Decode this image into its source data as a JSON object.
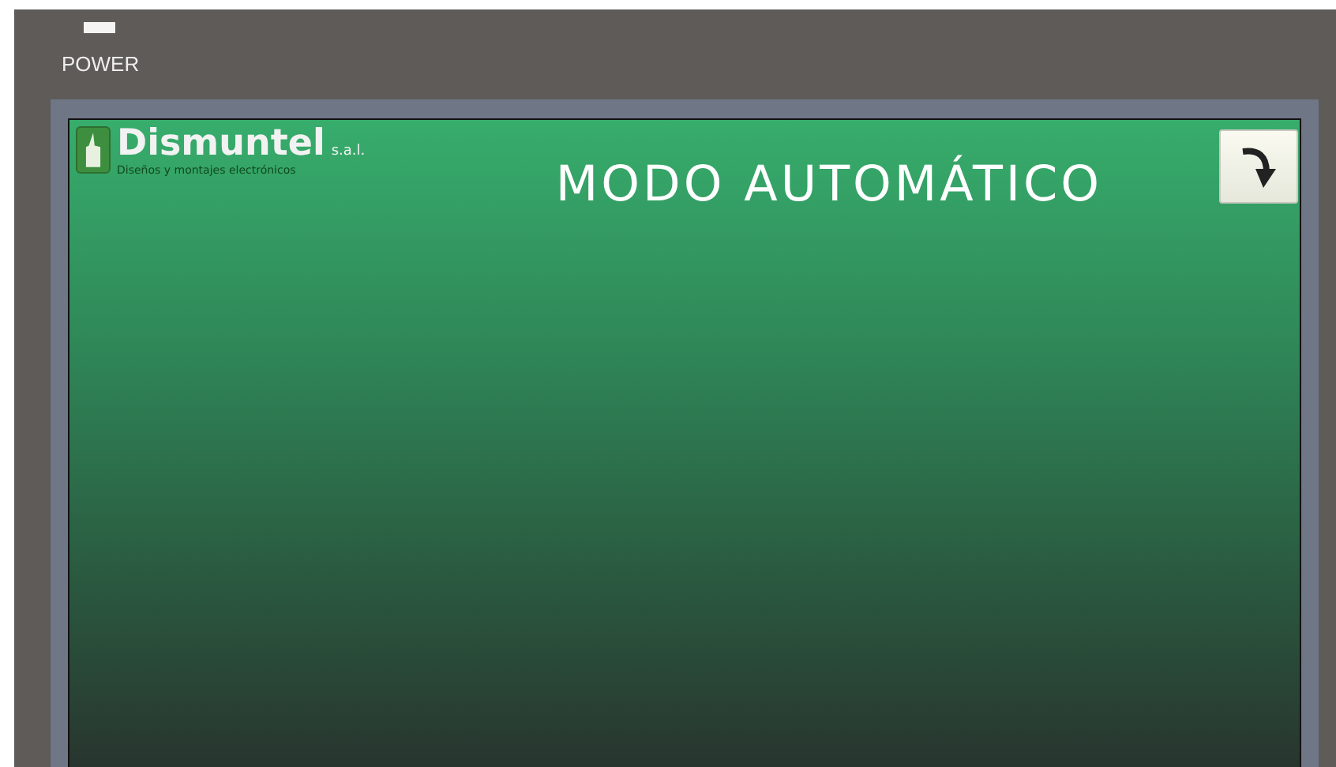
{
  "device": {
    "power_label": "POWER",
    "power_on": true
  },
  "screen": {
    "logo": {
      "name": "Dismuntel",
      "suffix": "s.a.l.",
      "tagline": "Diseños y montajes electrónicos"
    },
    "title": "MODO AUTOMÁTICO"
  }
}
